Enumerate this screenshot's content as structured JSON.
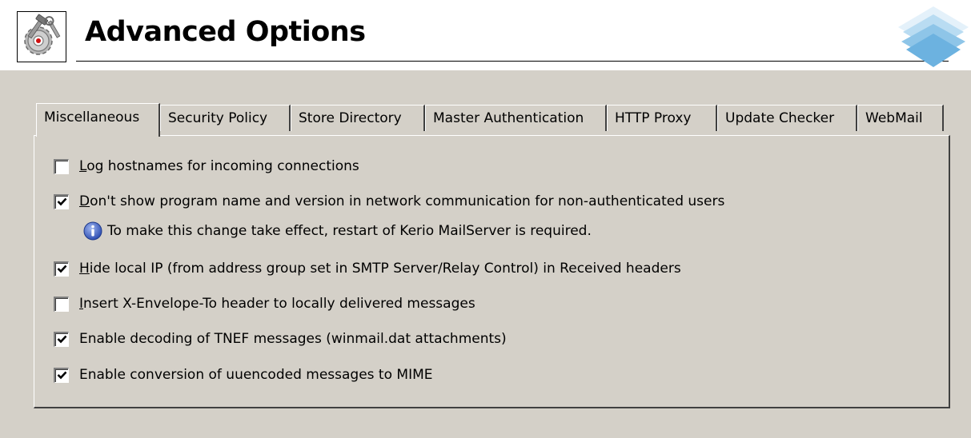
{
  "header": {
    "title": "Advanced Options",
    "icon": "settings-tools-icon",
    "logo": "kerio-logo"
  },
  "tabs": [
    {
      "label": "Miscellaneous",
      "active": true
    },
    {
      "label": "Security Policy",
      "active": false
    },
    {
      "label": "Store Directory",
      "active": false
    },
    {
      "label": "Master Authentication",
      "active": false
    },
    {
      "label": "HTTP Proxy",
      "active": false
    },
    {
      "label": "Update Checker",
      "active": false
    },
    {
      "label": "WebMail",
      "active": false
    }
  ],
  "options": [
    {
      "accel": "L",
      "rest": "og hostnames for incoming connections",
      "checked": false
    },
    {
      "accel": "D",
      "rest": "on't show program name and version in network communication for non-authenticated users",
      "checked": true
    },
    {
      "accel": "H",
      "rest": "ide local IP (from address group set in SMTP Server/Relay Control) in Received headers",
      "checked": true
    },
    {
      "accel": "I",
      "rest": "nsert X-Envelope-To header to locally delivered messages",
      "checked": false
    },
    {
      "accel": "",
      "rest": "Enable decoding of TNEF messages (winmail.dat attachments)",
      "checked": true
    },
    {
      "accel": "",
      "rest": "Enable conversion of uuencoded messages to MIME",
      "checked": true
    }
  ],
  "note": {
    "icon": "info-icon",
    "text": "To make this change take effect, restart of Kerio MailServer is required."
  },
  "colors": {
    "window_bg": "#d4d0c8",
    "header_bg": "#ffffff",
    "info_icon": "#2f4fb3",
    "logo_blue": "#8ec5e8"
  }
}
